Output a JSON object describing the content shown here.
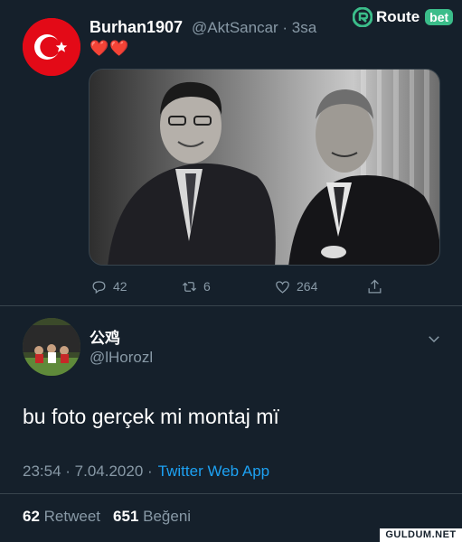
{
  "watermark_top": {
    "brand": "Route",
    "badge": "bet"
  },
  "tweet1": {
    "display_name": "Burhan1907",
    "handle_time": "@AktSancar · 3sa",
    "emoji": "❤️❤️",
    "actions": {
      "replies": "42",
      "retweets": "6",
      "likes": "264"
    }
  },
  "tweet2": {
    "display_name": "公鸡",
    "handle": "@lHorozl",
    "text": "bu foto gerçek mi montaj mï",
    "time": "23:54 · 7.04.2020 ·",
    "app": "Twitter Web App",
    "retweet_count": "62",
    "retweet_label": "Retweet",
    "like_count": "651",
    "like_label": "Beğeni"
  },
  "watermark_bottom": "GULDUM.NET",
  "colors": {
    "background": "#15202b",
    "secondary_text": "#8899a6",
    "link": "#1da1f2",
    "flag_red": "#e30a17"
  }
}
